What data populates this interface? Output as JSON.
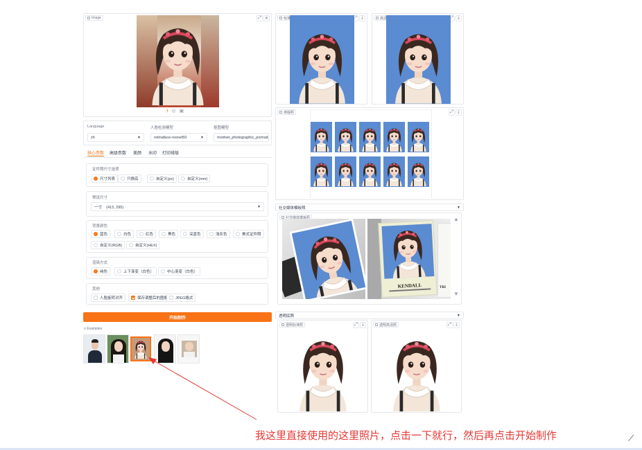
{
  "image_panel": {
    "label": "Image"
  },
  "upload_icons": [
    "upload-icon",
    "clipboard-icon",
    "webcam-icon"
  ],
  "settings": {
    "language": {
      "label": "Language",
      "value": "zh"
    },
    "face_model": {
      "label": "人脸检测模型",
      "value": "retinaface-resnet50"
    },
    "matting_model": {
      "label": "抠图模型",
      "value": "modnet_photographic_portrait_matting"
    }
  },
  "tabs": [
    "核心参数",
    "高级参数",
    "美颜",
    "水印",
    "打印排版"
  ],
  "size_list_group": {
    "label": "证件照尺寸选项",
    "options": [
      "尺寸列表",
      "只换底",
      "自定义(px)",
      "自定义(mm)"
    ],
    "selected": 0
  },
  "size_group": {
    "label": "预设尺寸",
    "value": "一寸    (413, 295)"
  },
  "bg_color_group": {
    "label": "背景颜色",
    "options": [
      "蓝色",
      "白色",
      "红色",
      "黑色",
      "深蓝色",
      "浅灰色",
      "美式证件照",
      "自定义(RGB)",
      "自定义(HEX)"
    ],
    "selected": 0
  },
  "render_group": {
    "label": "渲染方式",
    "options": [
      "纯色",
      "上下渐变（白色）",
      "中心渐变（白色）"
    ],
    "selected": 0
  },
  "other_group": {
    "label": "其他",
    "options": [
      "人脸旋转对齐",
      "保存调整后的图像",
      "JPEG格式"
    ],
    "checked": [
      false,
      true,
      false
    ]
  },
  "start_button": "开始制作",
  "examples": {
    "label": "Examples"
  },
  "output": {
    "standard": "标准照",
    "hd": "高清照",
    "layout": "排版照",
    "social_section": "社交媒体模板照",
    "social_gallery": "社交媒体模板照",
    "template_caption_1": "KENDALL",
    "template_caption_2": "TRI",
    "transparent_section": "透明底照",
    "transparent_standard": "透明标准照",
    "transparent_hd": "透明高清照"
  },
  "annotation": "我这里直接使用的这里照片，点击一下就行，然后再点击开始制作",
  "colors": {
    "accent": "#f97316",
    "photo_bg": "#5b8bd1",
    "annotation": "#e53935"
  }
}
